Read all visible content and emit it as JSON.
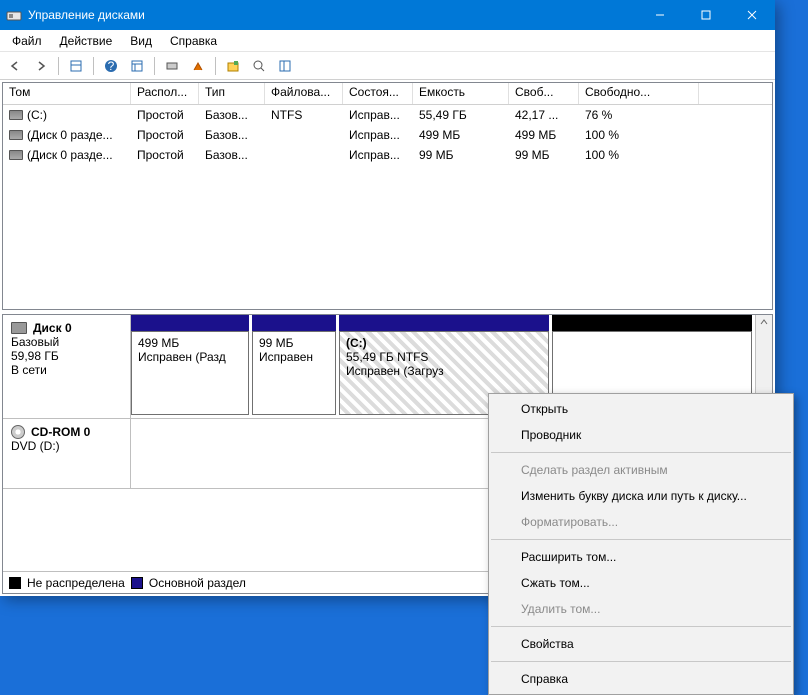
{
  "title": "Управление дисками",
  "menu": {
    "file": "Файл",
    "action": "Действие",
    "view": "Вид",
    "help": "Справка"
  },
  "columns": [
    "Том",
    "Распол...",
    "Тип",
    "Файлова...",
    "Состоя...",
    "Емкость",
    "Своб...",
    "Свободно..."
  ],
  "rows": [
    {
      "name": "(C:)",
      "layout": "Простой",
      "type": "Базов...",
      "fs": "NTFS",
      "status": "Исправ...",
      "cap": "55,49 ГБ",
      "free": "42,17 ...",
      "pct": "76 %"
    },
    {
      "name": "(Диск 0 разде...",
      "layout": "Простой",
      "type": "Базов...",
      "fs": "",
      "status": "Исправ...",
      "cap": "499 МБ",
      "free": "499 МБ",
      "pct": "100 %"
    },
    {
      "name": "(Диск 0 разде...",
      "layout": "Простой",
      "type": "Базов...",
      "fs": "",
      "status": "Исправ...",
      "cap": "99 МБ",
      "free": "99 МБ",
      "pct": "100 %"
    }
  ],
  "disk0": {
    "label": "Диск 0",
    "type": "Базовый",
    "size": "59,98 ГБ",
    "state": "В сети",
    "parts": [
      {
        "title": "",
        "line1": "499 МБ",
        "line2": "Исправен (Разд"
      },
      {
        "title": "",
        "line1": "99 МБ",
        "line2": "Исправен"
      },
      {
        "title": "(C:)",
        "line1": "55,49 ГБ NTFS",
        "line2": "Исправен (Загруз"
      },
      {
        "title": "",
        "line1": "",
        "line2": ""
      }
    ]
  },
  "cdrom": {
    "label": "CD-ROM 0",
    "sub": "DVD (D:)"
  },
  "legend": {
    "unalloc": "Не распределена",
    "primary": "Основной раздел"
  },
  "ctx": {
    "open": "Открыть",
    "explorer": "Проводник",
    "active": "Сделать раздел активным",
    "letter": "Изменить букву диска или путь к диску...",
    "format": "Форматировать...",
    "extend": "Расширить том...",
    "shrink": "Сжать том...",
    "delete": "Удалить том...",
    "props": "Свойства",
    "help": "Справка"
  }
}
